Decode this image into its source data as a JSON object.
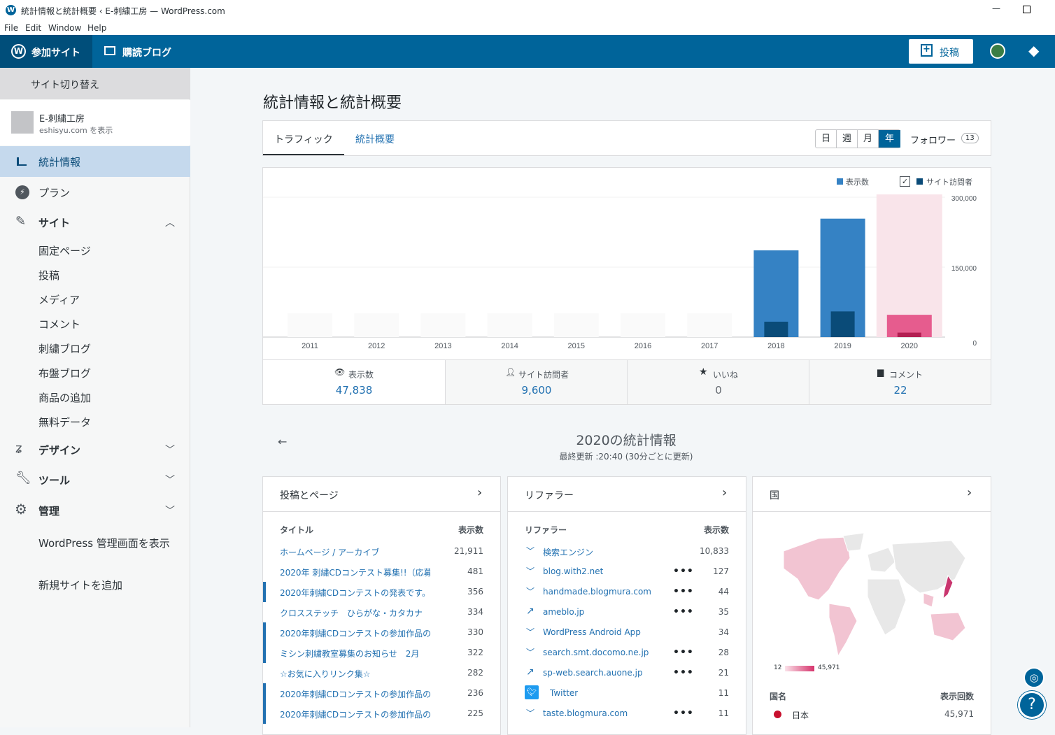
{
  "window": {
    "title": "統計情報と統計概要 ‹ E-刺繍工房 — WordPress.com",
    "minimize": "—",
    "maximize": "☐"
  },
  "menu": [
    "File",
    "Edit",
    "Window",
    "Help"
  ],
  "masterbar": {
    "my_sites": "参加サイト",
    "reader": "購読ブログ",
    "write": "投稿"
  },
  "sidebar": {
    "switch_site": "サイト切り替え",
    "site_name": "E-刺繍工房",
    "site_url": "eshisyu.com を表示",
    "stats": "統計情報",
    "plan": "プラン",
    "site": "サイト",
    "site_items": [
      "固定ページ",
      "投稿",
      "メディア",
      "コメント",
      "刺繍ブログ",
      "布盤ブログ",
      "商品の追加",
      "無料データ"
    ],
    "design": "デザイン",
    "tools": "ツール",
    "manage": "管理",
    "wp_admin": "WordPress 管理画面を表示",
    "add_site": "新規サイトを追加"
  },
  "page": {
    "title": "統計情報と統計概要"
  },
  "tabs": {
    "traffic": "トラフィック",
    "insights": "統計概要",
    "periods": [
      "日",
      "週",
      "月",
      "年"
    ],
    "followers": "フォロワー",
    "followers_count": "13"
  },
  "chart_data": {
    "type": "bar",
    "categories": [
      "2011",
      "2012",
      "2013",
      "2014",
      "2015",
      "2016",
      "2017",
      "2018",
      "2019",
      "2020"
    ],
    "series": [
      {
        "name": "表示数",
        "values": [
          0,
          0,
          0,
          0,
          0,
          0,
          0,
          186000,
          254000,
          47838
        ]
      },
      {
        "name": "サイト訪問者",
        "values": [
          0,
          0,
          0,
          0,
          0,
          0,
          0,
          33000,
          55000,
          9600
        ]
      }
    ],
    "ylim": [
      0,
      300000
    ],
    "yticks": [
      "300,000",
      "150,000",
      "0"
    ],
    "highlight": "2020",
    "colors": {
      "views": "#3582c4",
      "visitors": "#0a4b78",
      "hl_views": "#e65c8e",
      "hl_visitors": "#b21f52",
      "hl_bg": "#f9e4ea"
    }
  },
  "legend": {
    "views": "表示数",
    "visitors": "サイト訪問者"
  },
  "summary": [
    {
      "label": "表示数",
      "value": "47,838"
    },
    {
      "label": "サイト訪問者",
      "value": "9,600"
    },
    {
      "label": "いいね",
      "value": "0"
    },
    {
      "label": "コメント",
      "value": "22"
    }
  ],
  "period": {
    "title": "2020の統計情報",
    "updated": "最終更新 :20:40 (30分ごとに更新)"
  },
  "posts": {
    "title": "投稿とページ",
    "col_title": "タイトル",
    "col_views": "表示数",
    "rows": [
      {
        "label": "ホームページ / アーカイブ",
        "value": "21,911",
        "mark": false
      },
      {
        "label": "2020年 刺繍CDコンテスト募集!!（応募",
        "value": "481",
        "mark": false
      },
      {
        "label": "2020年刺繍CDコンテストの発表です。",
        "value": "356",
        "mark": true
      },
      {
        "label": "クロスステッチ　ひらがな・カタカナ",
        "value": "334",
        "mark": false
      },
      {
        "label": "2020年刺繍CDコンテストの参加作品の",
        "value": "330",
        "mark": true
      },
      {
        "label": "ミシン刺繍教室募集のお知らせ　2月",
        "value": "322",
        "mark": true
      },
      {
        "label": "☆お気に入りリンク集☆",
        "value": "282",
        "mark": false
      },
      {
        "label": "2020年刺繍CDコンテストの参加作品の",
        "value": "236",
        "mark": true
      },
      {
        "label": "2020年刺繍CDコンテストの参加作品の",
        "value": "225",
        "mark": true
      }
    ]
  },
  "referrers": {
    "title": "リファラー",
    "col_title": "リファラー",
    "col_views": "表示数",
    "rows": [
      {
        "label": "検索エンジン",
        "value": "10,833",
        "icon": "chevron",
        "dots": false
      },
      {
        "label": "blog.with2.net",
        "value": "127",
        "icon": "chevron",
        "dots": true
      },
      {
        "label": "handmade.blogmura.com",
        "value": "44",
        "icon": "chevron",
        "dots": true
      },
      {
        "label": "ameblo.jp",
        "value": "35",
        "icon": "external",
        "dots": true
      },
      {
        "label": "WordPress Android App",
        "value": "34",
        "icon": "chevron",
        "dots": false
      },
      {
        "label": "search.smt.docomo.ne.jp",
        "value": "28",
        "icon": "chevron",
        "dots": true
      },
      {
        "label": "sp-web.search.auone.jp",
        "value": "21",
        "icon": "external",
        "dots": true
      },
      {
        "label": "Twitter",
        "value": "11",
        "icon": "twitter",
        "dots": false
      },
      {
        "label": "taste.blogmura.com",
        "value": "11",
        "icon": "chevron",
        "dots": true
      }
    ]
  },
  "countries": {
    "title": "国",
    "scale_min": "12",
    "scale_max": "45,971",
    "col_country": "国名",
    "col_views": "表示回数",
    "rows": [
      {
        "label": "日本",
        "value": "45,971"
      }
    ]
  }
}
